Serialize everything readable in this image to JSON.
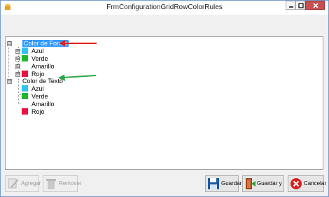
{
  "window": {
    "title": "FrmConfigurationGridRowColorRules"
  },
  "tree": {
    "groups": [
      {
        "label": "Color de Fondo",
        "expander": "⊟",
        "selected": true,
        "items": [
          {
            "label": "Azul",
            "color": "#2ec4f0",
            "expander": "⊞"
          },
          {
            "label": "Verde",
            "color": "#1fb82b",
            "expander": "⊞"
          },
          {
            "label": "Amarillo",
            "color": "#ffffff",
            "expander": "⊞"
          },
          {
            "label": "Rojo",
            "color": "#ee1144",
            "expander": "⊞"
          }
        ]
      },
      {
        "label": "Color de Texto",
        "expander": "⊟",
        "selected": false,
        "items": [
          {
            "label": "Azul",
            "color": "#2ec4f0"
          },
          {
            "label": "Verde",
            "color": "#1fb82b"
          },
          {
            "label": "Amarillo",
            "color": "#ffffff"
          },
          {
            "label": "Rojo",
            "color": "#ee1144"
          }
        ]
      }
    ]
  },
  "buttons": {
    "agregar": "Agregar",
    "remover": "Remover",
    "guardar": "Guardar",
    "guardar_salir": "Guardar y Salir",
    "cancelar": "Cancelar"
  },
  "annotations": {
    "red_arrow_color": "#e02020",
    "green_arrow_color": "#2aa84a"
  }
}
